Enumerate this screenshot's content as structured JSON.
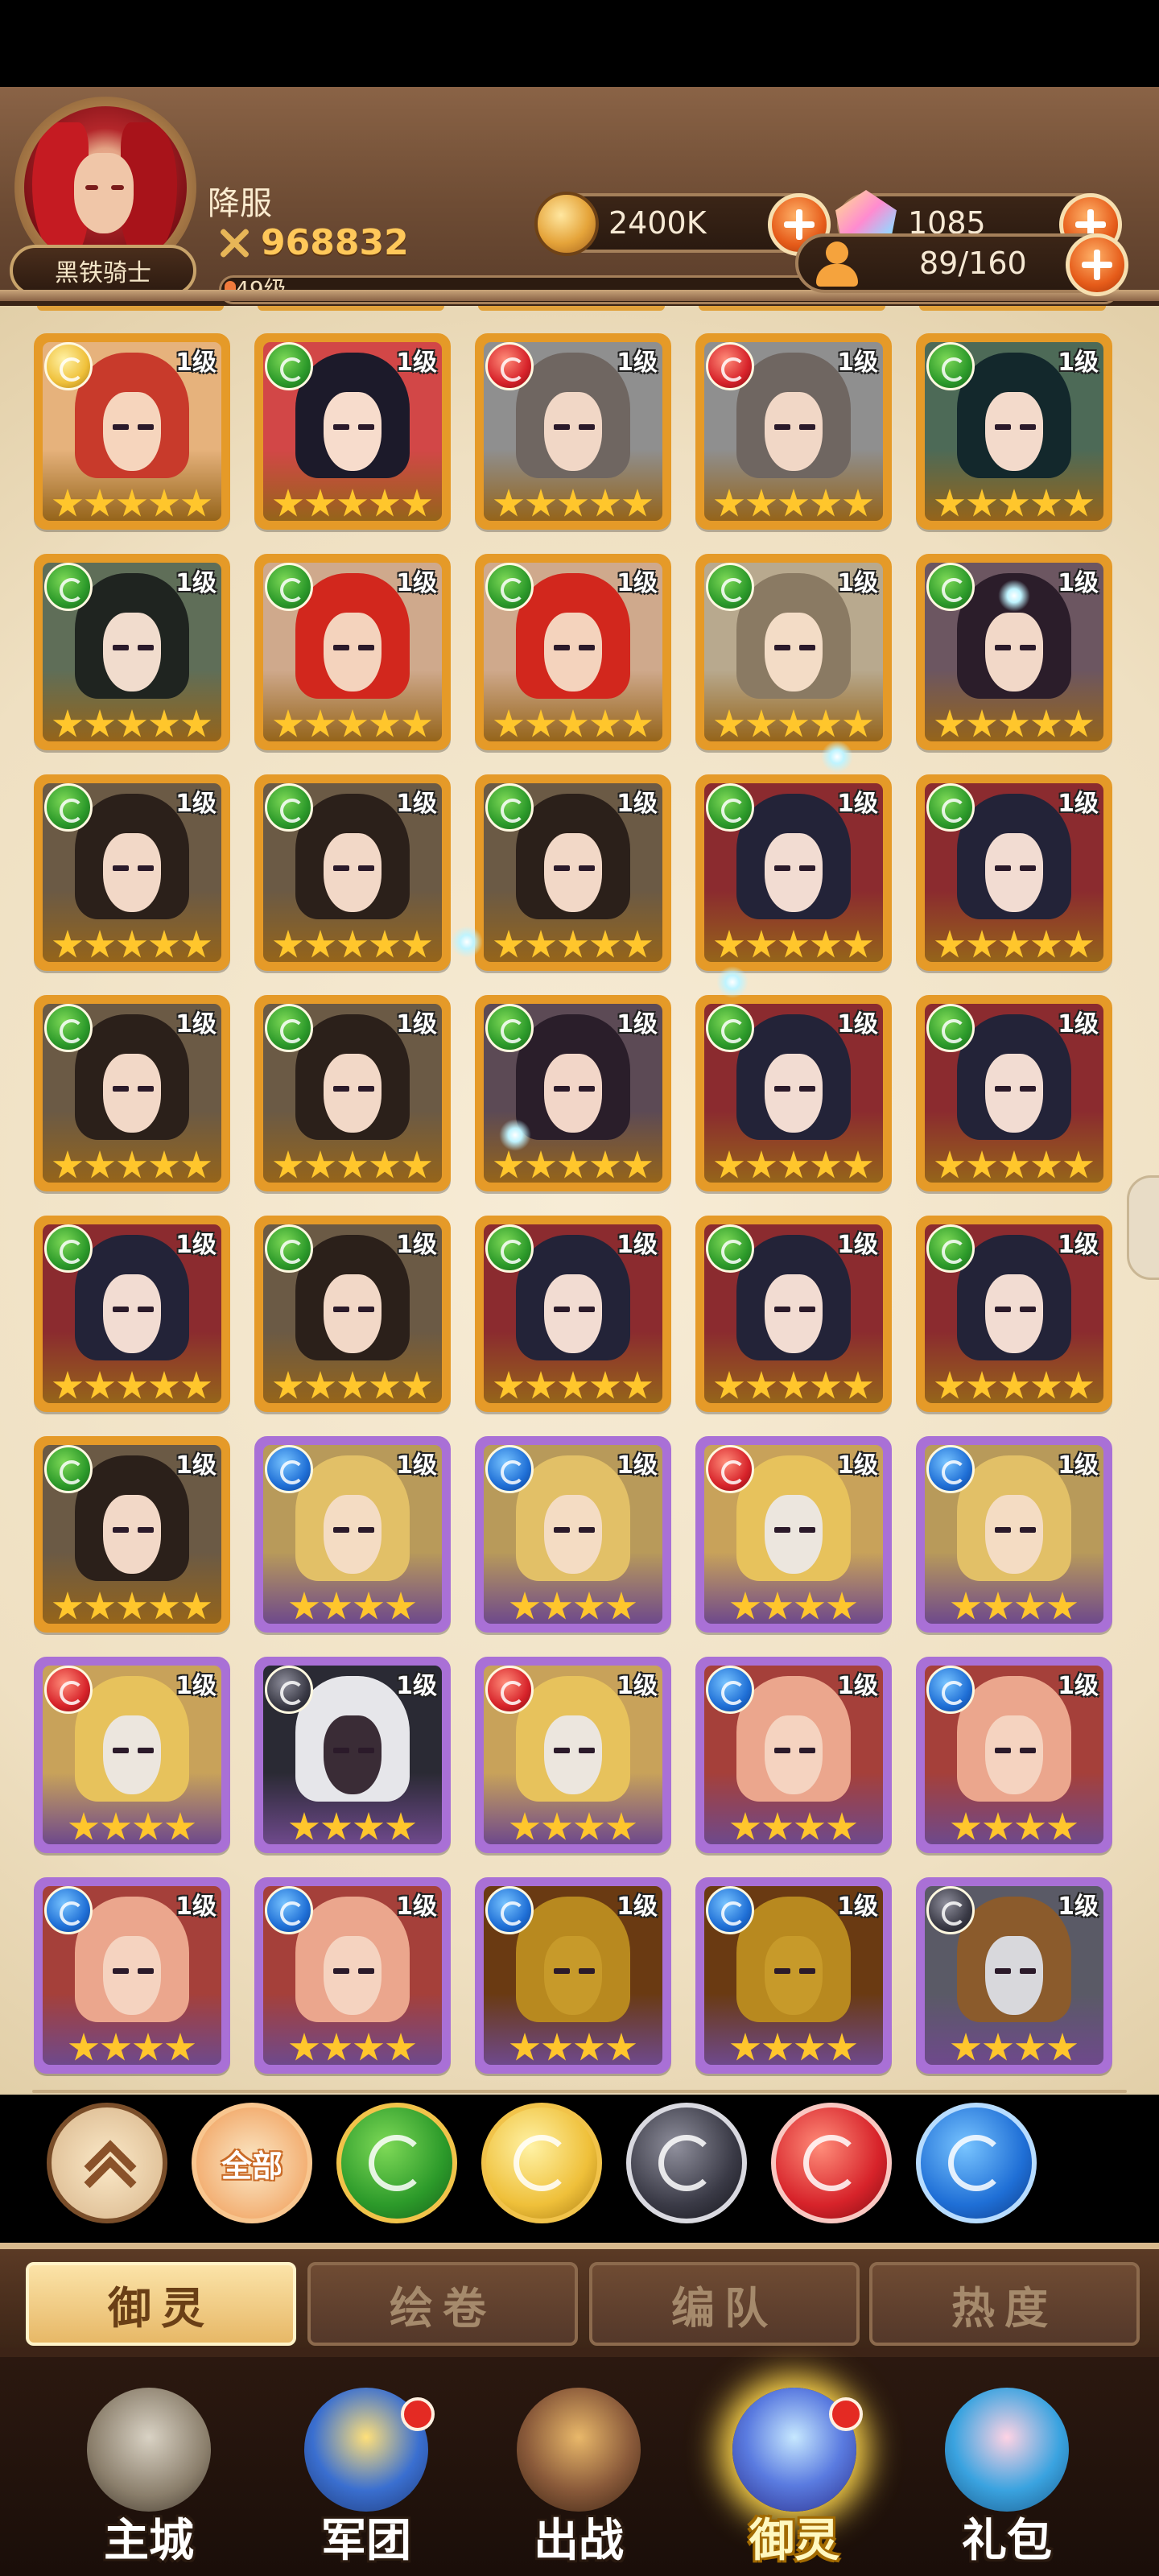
{
  "header": {
    "player_name": "降服",
    "power": "968832",
    "level_text": "49级",
    "level_progress": 0.01,
    "title_badge": "黑铁骑士",
    "gold": "2400K",
    "crystals": "1085",
    "hero_count": "89/160"
  },
  "cards": [
    {
      "el": "rose",
      "frame": "orange",
      "lvl": "1级",
      "stars": 5,
      "hair": "#c83a2b",
      "skin": "#f6d5bd",
      "bg": "#e6b27c"
    },
    {
      "el": "leaf",
      "frame": "orange",
      "lvl": "1级",
      "stars": 5,
      "hair": "#1c1a2a",
      "skin": "#f7dccc",
      "bg": "#d24747"
    },
    {
      "el": "flame",
      "frame": "orange",
      "lvl": "1级",
      "stars": 5,
      "hair": "#6f6661",
      "skin": "#f1d7c6",
      "bg": "#8f8f8f"
    },
    {
      "el": "flame",
      "frame": "orange",
      "lvl": "1级",
      "stars": 5,
      "hair": "#6f6661",
      "skin": "#f1d7c6",
      "bg": "#8f8f8f"
    },
    {
      "el": "leaf",
      "frame": "orange",
      "lvl": "1级",
      "stars": 5,
      "hair": "#13282c",
      "skin": "#f3dacb",
      "bg": "#4d6a57"
    },
    {
      "el": "leaf",
      "frame": "orange",
      "lvl": "1级",
      "stars": 5,
      "hair": "#1f2420",
      "skin": "#f1dccd",
      "bg": "#5f6e58"
    },
    {
      "el": "leaf",
      "frame": "orange",
      "lvl": "1级",
      "stars": 5,
      "hair": "#d2271d",
      "skin": "#f4d3bd",
      "bg": "#cfa98c"
    },
    {
      "el": "leaf",
      "frame": "orange",
      "lvl": "1级",
      "stars": 5,
      "hair": "#d2271d",
      "skin": "#f4d3bd",
      "bg": "#cfa98c"
    },
    {
      "el": "leaf",
      "frame": "orange",
      "lvl": "1级",
      "stars": 5,
      "hair": "#8a7a63",
      "skin": "#f3dcc6",
      "bg": "#b8a98e"
    },
    {
      "el": "leaf",
      "frame": "orange",
      "lvl": "1级",
      "stars": 5,
      "hair": "#2b1d2a",
      "skin": "#f2d8c8",
      "bg": "#6c5661"
    },
    {
      "el": "leaf",
      "frame": "orange",
      "lvl": "1级",
      "stars": 5,
      "hair": "#2b201a",
      "skin": "#f2d8c7",
      "bg": "#6b5a45"
    },
    {
      "el": "leaf",
      "frame": "orange",
      "lvl": "1级",
      "stars": 5,
      "hair": "#2b201a",
      "skin": "#f2d8c7",
      "bg": "#6b5a45"
    },
    {
      "el": "leaf",
      "frame": "orange",
      "lvl": "1级",
      "stars": 5,
      "hair": "#2b201a",
      "skin": "#f2d8c7",
      "bg": "#6b5a45"
    },
    {
      "el": "leaf",
      "frame": "orange",
      "lvl": "1级",
      "stars": 5,
      "hair": "#232338",
      "skin": "#f2dcd2",
      "bg": "#8b2b2f"
    },
    {
      "el": "leaf",
      "frame": "orange",
      "lvl": "1级",
      "stars": 5,
      "hair": "#232338",
      "skin": "#f2dcd2",
      "bg": "#8b2b2f"
    },
    {
      "el": "leaf",
      "frame": "orange",
      "lvl": "1级",
      "stars": 5,
      "hair": "#2b201a",
      "skin": "#f2d8c7",
      "bg": "#6b5a45"
    },
    {
      "el": "leaf",
      "frame": "orange",
      "lvl": "1级",
      "stars": 5,
      "hair": "#2b201a",
      "skin": "#f2d8c7",
      "bg": "#6b5a45"
    },
    {
      "el": "leaf",
      "frame": "orange",
      "lvl": "1级",
      "stars": 5,
      "hair": "#2a1e2a",
      "skin": "#f2d6c8",
      "bg": "#5c4a55"
    },
    {
      "el": "leaf",
      "frame": "orange",
      "lvl": "1级",
      "stars": 5,
      "hair": "#232338",
      "skin": "#f2dcd2",
      "bg": "#8b2b2f"
    },
    {
      "el": "leaf",
      "frame": "orange",
      "lvl": "1级",
      "stars": 5,
      "hair": "#232338",
      "skin": "#f2dcd2",
      "bg": "#8b2b2f"
    },
    {
      "el": "leaf",
      "frame": "orange",
      "lvl": "1级",
      "stars": 5,
      "hair": "#232338",
      "skin": "#f2dcd2",
      "bg": "#8b2b2f"
    },
    {
      "el": "leaf",
      "frame": "orange",
      "lvl": "1级",
      "stars": 5,
      "hair": "#2b201a",
      "skin": "#f2d8c7",
      "bg": "#6b5a45"
    },
    {
      "el": "leaf",
      "frame": "orange",
      "lvl": "1级",
      "stars": 5,
      "hair": "#232338",
      "skin": "#f2dcd2",
      "bg": "#8b2b2f"
    },
    {
      "el": "leaf",
      "frame": "orange",
      "lvl": "1级",
      "stars": 5,
      "hair": "#232338",
      "skin": "#f2dcd2",
      "bg": "#8b2b2f"
    },
    {
      "el": "leaf",
      "frame": "orange",
      "lvl": "1级",
      "stars": 5,
      "hair": "#232338",
      "skin": "#f2dcd2",
      "bg": "#8b2b2f"
    },
    {
      "el": "leaf",
      "frame": "orange",
      "lvl": "1级",
      "stars": 5,
      "hair": "#2b201a",
      "skin": "#f2d8c7",
      "bg": "#6b5a45"
    },
    {
      "el": "water",
      "frame": "purple",
      "lvl": "1级",
      "stars": 4,
      "hair": "#e2c067",
      "skin": "#f4dcc3",
      "bg": "#b89a5a"
    },
    {
      "el": "water",
      "frame": "purple",
      "lvl": "1级",
      "stars": 4,
      "hair": "#e2c067",
      "skin": "#f4dcc3",
      "bg": "#b89a5a"
    },
    {
      "el": "flame",
      "frame": "purple",
      "lvl": "1级",
      "stars": 4,
      "hair": "#e7c25c",
      "skin": "#ece6de",
      "bg": "#c8a25a"
    },
    {
      "el": "water",
      "frame": "purple",
      "lvl": "1级",
      "stars": 4,
      "hair": "#e2c067",
      "skin": "#f4dcc3",
      "bg": "#b89a5a"
    },
    {
      "el": "flame",
      "frame": "purple",
      "lvl": "1级",
      "stars": 4,
      "hair": "#e7c25c",
      "skin": "#ece6de",
      "bg": "#c8a25a"
    },
    {
      "el": "dark",
      "frame": "purple",
      "lvl": "1级",
      "stars": 4,
      "hair": "#e6e6ea",
      "skin": "#3a2c36",
      "bg": "#2a2a34"
    },
    {
      "el": "flame",
      "frame": "purple",
      "lvl": "1级",
      "stars": 4,
      "hair": "#e7c25c",
      "skin": "#ece6de",
      "bg": "#c8a25a"
    },
    {
      "el": "water",
      "frame": "purple",
      "lvl": "1级",
      "stars": 4,
      "hair": "#eba68d",
      "skin": "#f5d3c0",
      "bg": "#a5403a"
    },
    {
      "el": "water",
      "frame": "purple",
      "lvl": "1级",
      "stars": 4,
      "hair": "#eba68d",
      "skin": "#f5d3c0",
      "bg": "#a5403a"
    },
    {
      "el": "water",
      "frame": "purple",
      "lvl": "1级",
      "stars": 4,
      "hair": "#eba68d",
      "skin": "#f5d3c0",
      "bg": "#a5403a"
    },
    {
      "el": "water",
      "frame": "purple",
      "lvl": "1级",
      "stars": 4,
      "hair": "#eba68d",
      "skin": "#f5d3c0",
      "bg": "#a5403a"
    },
    {
      "el": "water",
      "frame": "purple",
      "lvl": "1级",
      "stars": 4,
      "hair": "#b8891f",
      "skin": "#c79a2a",
      "bg": "#6a3a12"
    },
    {
      "el": "water",
      "frame": "purple",
      "lvl": "1级",
      "stars": 4,
      "hair": "#b8891f",
      "skin": "#c79a2a",
      "bg": "#6a3a12"
    },
    {
      "el": "dark",
      "frame": "purple",
      "lvl": "1级",
      "stars": 4,
      "hair": "#8b5b2c",
      "skin": "#d8d8dc",
      "bg": "#5a5a66"
    }
  ],
  "filters": {
    "all_label": "全部"
  },
  "tabs": [
    "御灵",
    "绘卷",
    "编队",
    "热度"
  ],
  "nav": [
    "主城",
    "军团",
    "出战",
    "御灵",
    "礼包"
  ]
}
